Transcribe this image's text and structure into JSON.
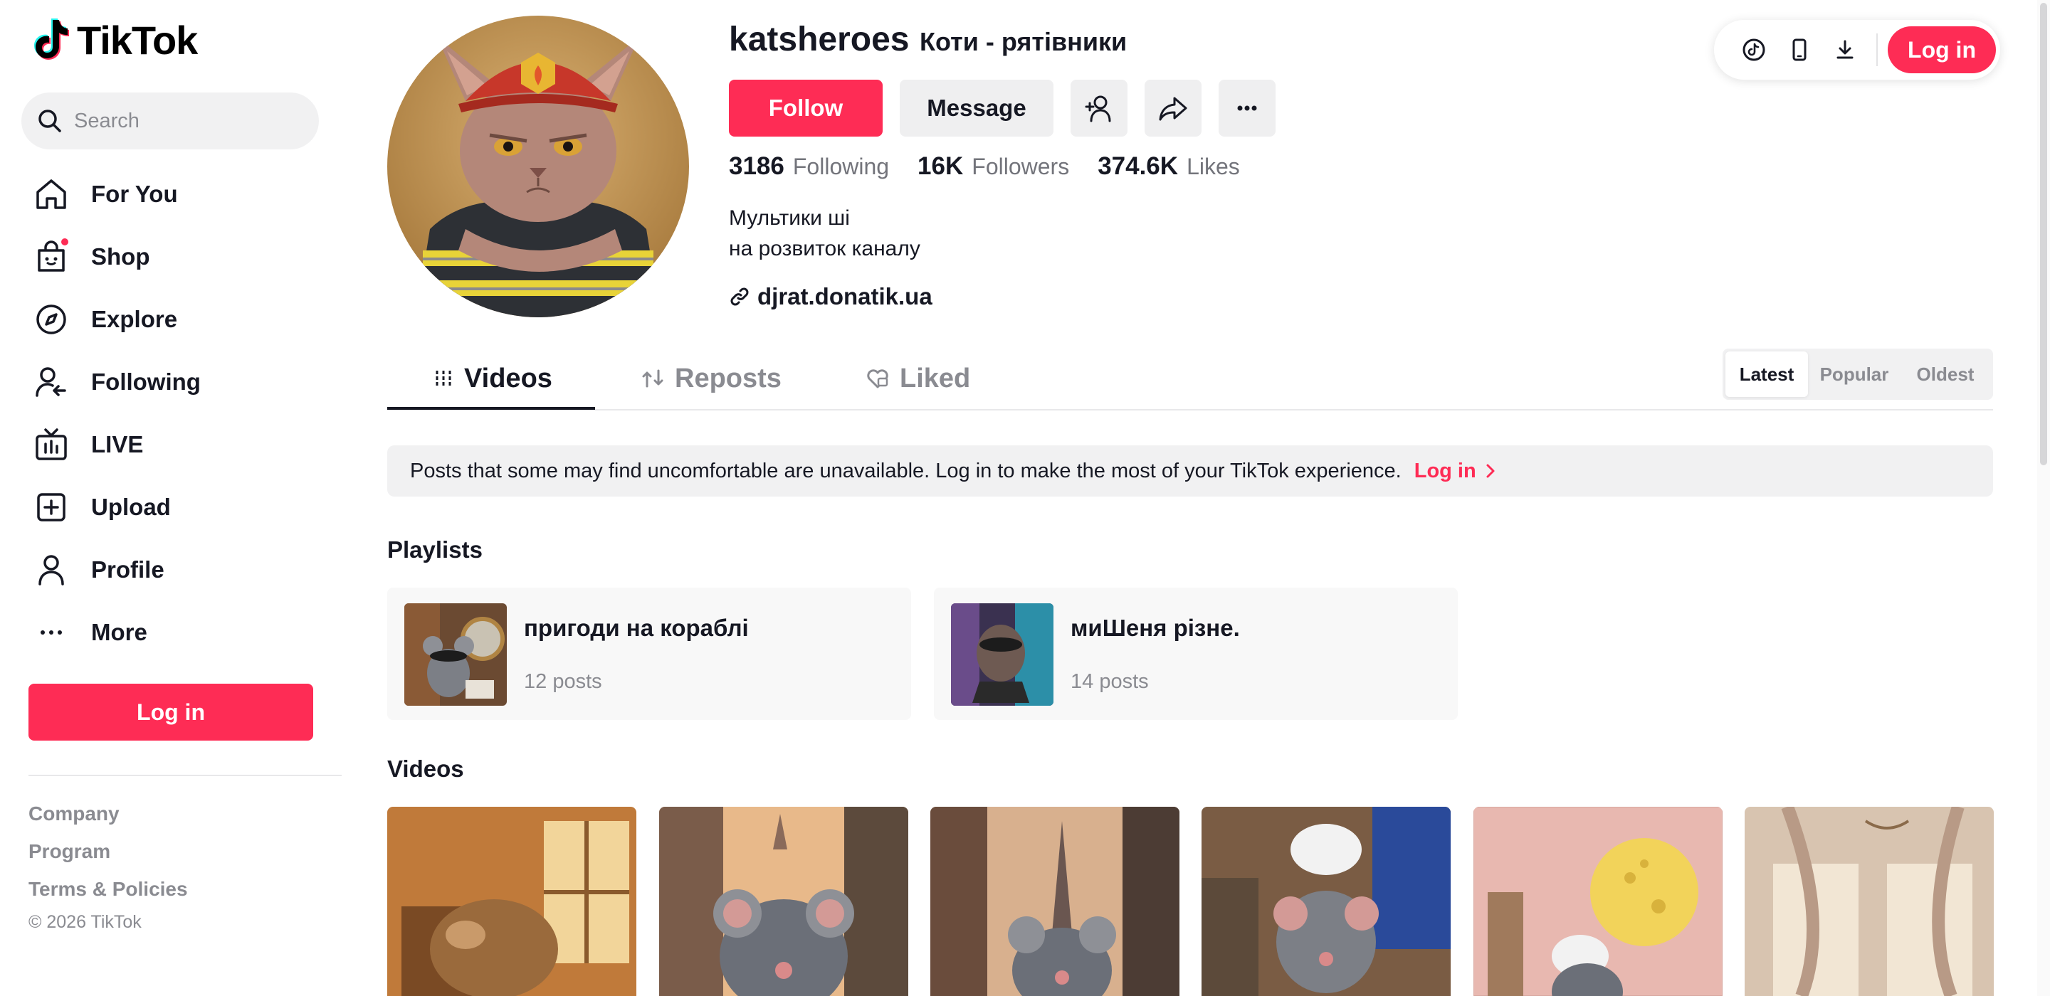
{
  "brand": {
    "name": "TikTok",
    "accent": "#fe2c55"
  },
  "search": {
    "placeholder": "Search"
  },
  "sidebar": {
    "items": [
      {
        "label": "For You",
        "icon": "home-icon"
      },
      {
        "label": "Shop",
        "icon": "shop-icon"
      },
      {
        "label": "Explore",
        "icon": "compass-icon"
      },
      {
        "label": "Following",
        "icon": "following-icon"
      },
      {
        "label": "LIVE",
        "icon": "live-icon"
      },
      {
        "label": "Upload",
        "icon": "upload-icon"
      },
      {
        "label": "Profile",
        "icon": "profile-icon"
      },
      {
        "label": "More",
        "icon": "more-icon"
      }
    ],
    "login_label": "Log in",
    "footer": [
      "Company",
      "Program",
      "Terms & Policies"
    ],
    "copyright": "© 2026 TikTok"
  },
  "header": {
    "login_label": "Log in",
    "icons": [
      "tiktok-coin-icon",
      "mobile-icon",
      "download-icon"
    ]
  },
  "profile": {
    "username": "katsheroes",
    "nickname": "Коти - рятівники",
    "follow_label": "Follow",
    "message_label": "Message",
    "stats": [
      {
        "value": "3186",
        "label": "Following"
      },
      {
        "value": "16K",
        "label": "Followers"
      },
      {
        "value": "374.6K",
        "label": "Likes"
      }
    ],
    "bio": [
      "Мультики ші",
      "на розвиток каналу"
    ],
    "link": "djrat.donatik.ua"
  },
  "tabs": [
    {
      "label": "Videos",
      "active": true
    },
    {
      "label": "Reposts",
      "active": false
    },
    {
      "label": "Liked",
      "active": false
    }
  ],
  "sort": {
    "options": [
      "Latest",
      "Popular",
      "Oldest"
    ],
    "selected": "Latest"
  },
  "banner": {
    "text": "Posts that some may find uncomfortable are unavailable. Log in to make the most of your TikTok experience.",
    "link_label": "Log in"
  },
  "playlists": {
    "title": "Playlists",
    "items": [
      {
        "title": "пригоди на кораблі",
        "count": "12 posts"
      },
      {
        "title": "миШеня різне.",
        "count": "14 posts"
      }
    ]
  },
  "videos": {
    "title": "Videos"
  }
}
